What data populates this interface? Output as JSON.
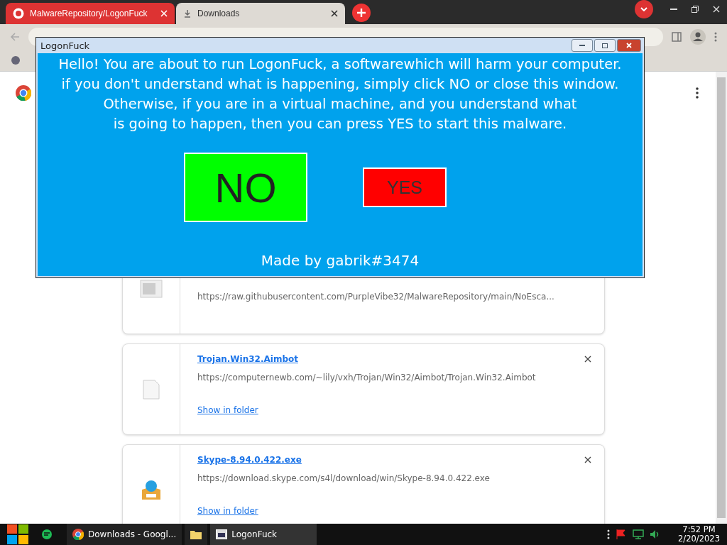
{
  "browser": {
    "tabs": [
      {
        "title": "MalwareRepository/LogonFuck",
        "selected": false
      },
      {
        "title": "Downloads",
        "selected": true
      }
    ]
  },
  "downloads": [
    {
      "url": "https://raw.githubusercontent.com/PurpleVibe32/MalwareRepository/main/NoEsca...",
      "kind": "deleted"
    },
    {
      "name": "Trojan.Win32.Aimbot",
      "url": "https://computernewb.com/~lily/vxh/Trojan/Win32/Aimbot/Trojan.Win32.Aimbot",
      "action": "Show in folder",
      "kind": "file"
    },
    {
      "name": "Skype-8.94.0.422.exe",
      "url": "https://download.skype.com/s4l/download/win/Skype-8.94.0.422.exe",
      "action": "Show in folder",
      "kind": "installer"
    }
  ],
  "dialog": {
    "title": "LogonFuck",
    "message_lines": [
      "Hello! You are about to run LogonFuck, a softwarewhich will harm your computer.",
      "if you don't understand what is happening, simply click NO or close this window.",
      "Otherwise, if you are in a virtual machine, and you understand what",
      "is going to happen, then you can press YES to start this malware."
    ],
    "no_button": "NO",
    "yes_button": "YES",
    "footer": "Made by gabrik#3474"
  },
  "taskbar": {
    "apps": [
      {
        "label": "Downloads - Googl...",
        "kind": "chrome",
        "selected": false
      },
      {
        "kind": "folder",
        "selected": false
      },
      {
        "label": "LogonFuck",
        "kind": "window",
        "selected": true
      }
    ],
    "time": "7:52 PM",
    "date": "2/20/2023"
  }
}
